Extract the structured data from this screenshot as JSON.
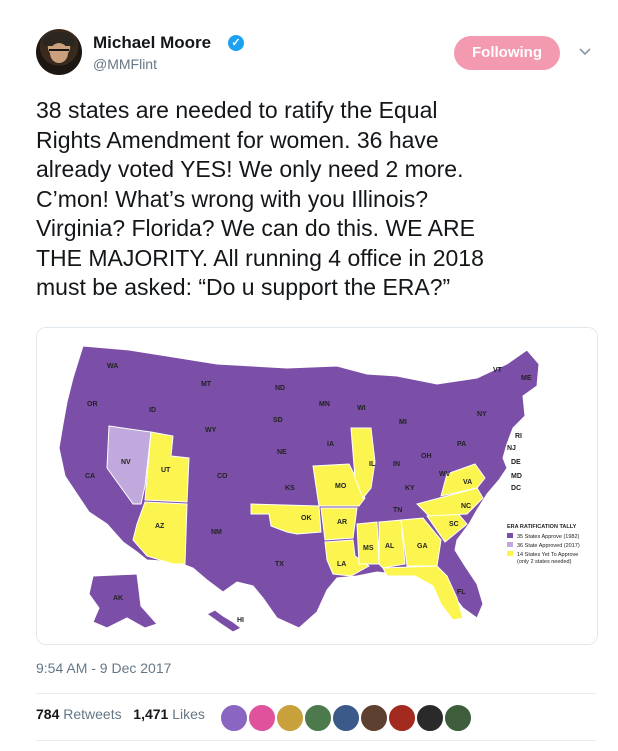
{
  "user": {
    "display_name": "Michael Moore",
    "handle": "@MMFlint",
    "verified_icon": "verified-badge-icon",
    "follow_label": "Following",
    "follow_color": "#f49ab0"
  },
  "tweet": {
    "lines": [
      "38 states are needed to ratify the Equal",
      "Rights Amendment for women. 36 have",
      "already voted YES! We only need 2 more.",
      "C’mon! What’s wrong with you Illinois?",
      "Virginia? Florida? We can do this. WE ARE",
      "THE MAJORITY. All running 4 office in 2018",
      "must be asked: “Do u support the ERA?”"
    ],
    "timestamp": "9:54 AM - 9 Dec 2017"
  },
  "map": {
    "colors": {
      "approved_1982": "#7b4fa7",
      "approved_2017": "#c2a9dd",
      "not_approved": "#fcf54f"
    },
    "legend": {
      "title": "ERA RATIFICATION TALLY",
      "items": [
        "35 States Approve (1982)",
        "36 State Approved (2017)",
        "14 States Yet To Approve",
        "(only 2 states needed)"
      ]
    },
    "state_labels": {
      "WA": "WA",
      "OR": "OR",
      "CA": "CA",
      "NV": "NV",
      "ID": "ID",
      "MT": "MT",
      "WY": "WY",
      "UT": "UT",
      "AZ": "AZ",
      "CO": "CO",
      "NM": "NM",
      "ND": "ND",
      "SD": "SD",
      "NE": "NE",
      "KS": "KS",
      "OK": "OK",
      "TX": "TX",
      "MN": "MN",
      "IA": "IA",
      "MO": "MO",
      "AR": "AR",
      "LA": "LA",
      "WI": "WI",
      "IL": "IL",
      "MI": "MI",
      "IN": "IN",
      "OH": "OH",
      "KY": "KY",
      "TN": "TN",
      "MS": "MS",
      "AL": "AL",
      "GA": "GA",
      "FL": "FL",
      "SC": "SC",
      "NC": "NC",
      "VA": "VA",
      "WV": "WV",
      "PA": "PA",
      "NY": "NY",
      "VT": "VT",
      "ME": "ME",
      "NJ": "NJ",
      "DE": "DE",
      "MD": "MD",
      "DC": "DC",
      "RI": "RI",
      "AK": "AK",
      "HI": "HI"
    }
  },
  "stats": {
    "retweets_count": "784",
    "retweets_label": "Retweets",
    "likes_count": "1,471",
    "likes_label": "Likes"
  }
}
